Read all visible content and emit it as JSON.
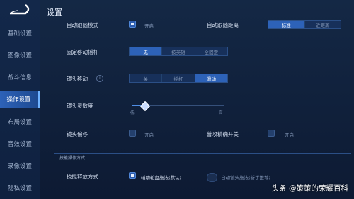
{
  "sidebar": {
    "items": [
      {
        "label": "基础设置",
        "active": false
      },
      {
        "label": "图像设置",
        "active": false
      },
      {
        "label": "战斗信息",
        "active": false
      },
      {
        "label": "操作设置",
        "active": true
      },
      {
        "label": "布局设置",
        "active": false
      },
      {
        "label": "音效设置",
        "active": false
      },
      {
        "label": "录像设置",
        "active": false
      },
      {
        "label": "隐私设置",
        "active": false
      }
    ]
  },
  "header": {
    "title": "设置"
  },
  "settings": {
    "row1_label": "自动跟随模式",
    "row1_option": "开启",
    "row1b_label": "自动跟随距离",
    "row1b_options": [
      "标准",
      "近距离"
    ],
    "row2_label": "固定移动摇杆",
    "row2_options": [
      "无",
      "按英雄",
      "全固定"
    ],
    "row3_label": "镜头移动",
    "row3_options": [
      "关",
      "摇杆",
      "滑动"
    ],
    "row4_label": "镜头灵敏度",
    "row4_min": "低",
    "row4_max": "高",
    "row4_value": 0.1,
    "row5_label": "镜头偏移",
    "row5_option": "开启",
    "row5b_label": "普攻精确开关",
    "row5b_option": "开启",
    "section_label": "技能操作方式",
    "row6_label": "技能释放方式",
    "row6_option": "辅助轮盘施法(默认)",
    "row6b_option": "自动镜头施法(新手推荐)"
  },
  "watermark": "头条 @策策的荣耀百科"
}
